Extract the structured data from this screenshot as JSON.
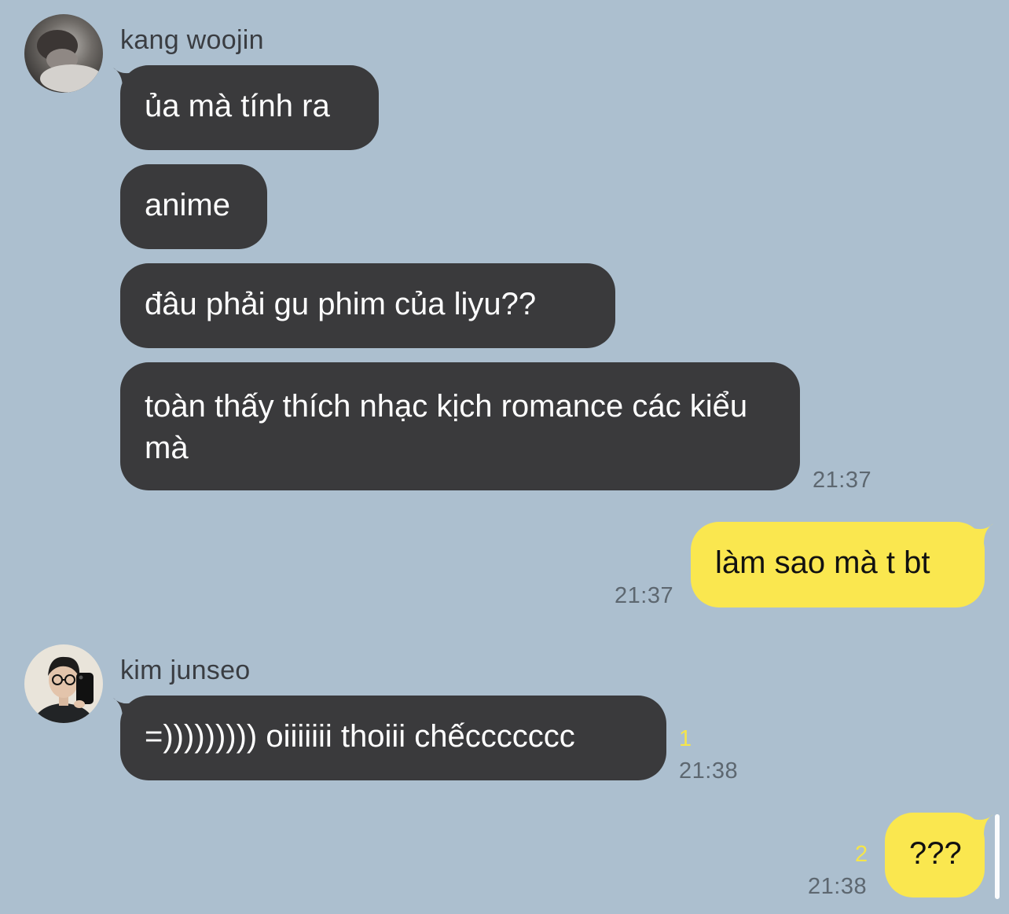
{
  "colors": {
    "background": "#acbfcf",
    "incoming_bubble": "#3a3a3c",
    "outgoing_bubble": "#fae74f",
    "unread_count": "#f5e54a"
  },
  "messages": [
    {
      "sender": "kang woojin",
      "avatar": "kang-woojin-avatar",
      "bubbles": [
        "ủa mà tính ra",
        "anime",
        "đâu phải gu phim của liyu??",
        "toàn thấy thích nhạc kịch romance các kiểu mà"
      ],
      "time": "21:37"
    },
    {
      "outgoing": true,
      "bubbles": [
        "làm sao mà t bt"
      ],
      "time": "21:37"
    },
    {
      "sender": "kim junseo",
      "avatar": "kim-junseo-avatar",
      "bubbles": [
        "=))))))))) oiiiiiii thoiii chếccccccc"
      ],
      "unread": "1",
      "time": "21:38"
    },
    {
      "outgoing": true,
      "bubbles": [
        "???"
      ],
      "unread": "2",
      "time": "21:38"
    }
  ]
}
